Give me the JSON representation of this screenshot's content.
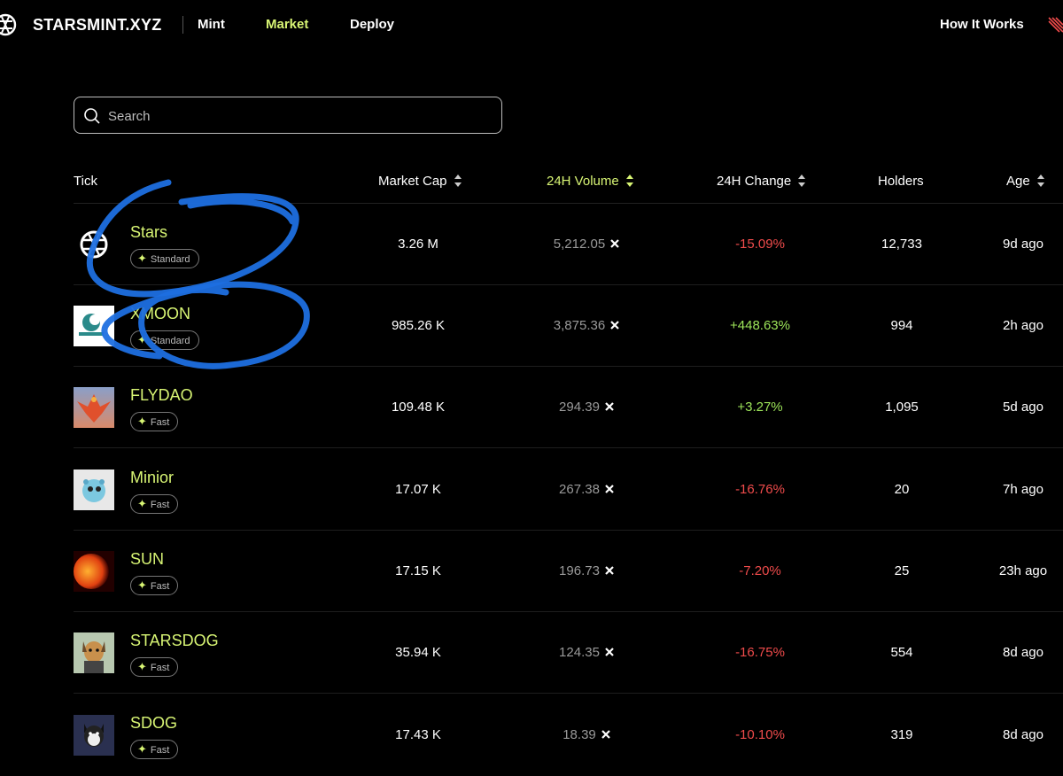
{
  "nav": {
    "brand": "STARSMINT.XYZ",
    "links": [
      "Mint",
      "Market",
      "Deploy"
    ],
    "active": "Market",
    "how_it_works": "How It Works"
  },
  "search": {
    "placeholder": "Search",
    "value": ""
  },
  "table": {
    "columns": [
      "Tick",
      "Market Cap",
      "24H Volume",
      "24H Change",
      "Holders",
      "Age"
    ],
    "sorted_column": "24H Volume",
    "rows": [
      {
        "tick": "Stars",
        "badge": "Standard",
        "market_cap": "3.26 M",
        "volume": "5,212.05",
        "change": "-15.09%",
        "holders": "12,733",
        "age": "9d ago"
      },
      {
        "tick": "XMOON",
        "badge": "Standard",
        "market_cap": "985.26 K",
        "volume": "3,875.36",
        "change": "+448.63%",
        "holders": "994",
        "age": "2h ago"
      },
      {
        "tick": "FLYDAO",
        "badge": "Fast",
        "market_cap": "109.48 K",
        "volume": "294.39",
        "change": "+3.27%",
        "holders": "1,095",
        "age": "5d ago"
      },
      {
        "tick": "Minior",
        "badge": "Fast",
        "market_cap": "17.07 K",
        "volume": "267.38",
        "change": "-16.76%",
        "holders": "20",
        "age": "7h ago"
      },
      {
        "tick": "SUN",
        "badge": "Fast",
        "market_cap": "17.15 K",
        "volume": "196.73",
        "change": "-7.20%",
        "holders": "25",
        "age": "23h ago"
      },
      {
        "tick": "STARSDOG",
        "badge": "Fast",
        "market_cap": "35.94 K",
        "volume": "124.35",
        "change": "-16.75%",
        "holders": "554",
        "age": "8d ago"
      },
      {
        "tick": "SDOG",
        "badge": "Fast",
        "market_cap": "17.43 K",
        "volume": "18.39",
        "change": "-10.10%",
        "holders": "319",
        "age": "8d ago"
      }
    ]
  },
  "colors": {
    "accent": "#d8f574",
    "positive": "#9ee65a",
    "negative": "#ef4b4b",
    "annotation": "#1e6fe0"
  }
}
